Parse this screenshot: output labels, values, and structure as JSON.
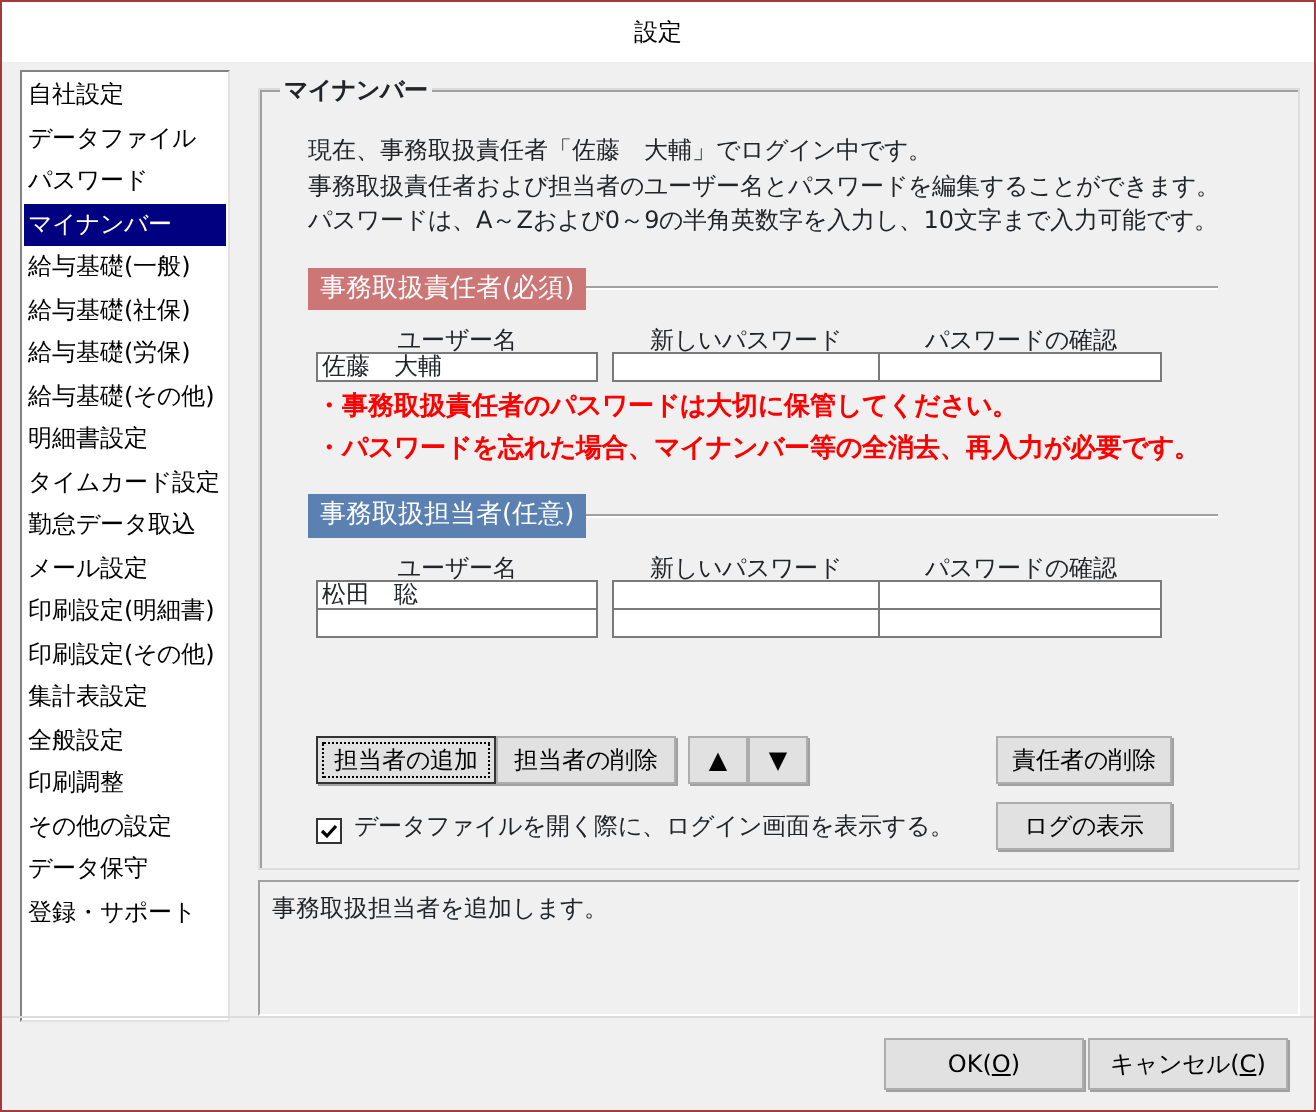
{
  "window": {
    "title": "設定"
  },
  "sidebar": {
    "items": [
      {
        "label": "自社設定",
        "selected": false
      },
      {
        "label": "データファイル",
        "selected": false
      },
      {
        "label": "パスワード",
        "selected": false
      },
      {
        "label": "マイナンバー",
        "selected": true
      },
      {
        "label": "給与基礎(一般)",
        "selected": false
      },
      {
        "label": "給与基礎(社保)",
        "selected": false
      },
      {
        "label": "給与基礎(労保)",
        "selected": false
      },
      {
        "label": "給与基礎(その他)",
        "selected": false
      },
      {
        "label": "明細書設定",
        "selected": false
      },
      {
        "label": "タイムカード設定",
        "selected": false
      },
      {
        "label": "勤怠データ取込",
        "selected": false
      },
      {
        "label": "メール設定",
        "selected": false
      },
      {
        "label": "印刷設定(明細書)",
        "selected": false
      },
      {
        "label": "印刷設定(その他)",
        "selected": false
      },
      {
        "label": "集計表設定",
        "selected": false
      },
      {
        "label": "全般設定",
        "selected": false
      },
      {
        "label": "印刷調整",
        "selected": false
      },
      {
        "label": "その他の設定",
        "selected": false
      },
      {
        "label": "データ保守",
        "selected": false
      },
      {
        "label": "登録・サポート",
        "selected": false
      }
    ]
  },
  "panel": {
    "title": "マイナンバー",
    "description": [
      "現在、事務取扱責任者「佐藤　大輔」でログイン中です。",
      "事務取扱責任者および担当者のユーザー名とパスワードを編集することができます。",
      "パスワードは、A～Zおよび0～9の半角英数字を入力し、10文字まで入力可能です。"
    ],
    "sections": [
      {
        "title": "事務取扱責任者(必須)",
        "color": "#cd7676",
        "columns": [
          "ユーザー名",
          "新しいパスワード",
          "パスワードの確認"
        ],
        "rows": [
          {
            "kind": "entry",
            "user_name": "佐藤　大輔"
          }
        ],
        "warnings": [
          "・事務取扱責任者のパスワードは大切に保管してください。",
          "・パスワードを忘れた場合、マイナンバー等の全消去、再入力が必要です。"
        ]
      },
      {
        "title": "事務取扱担当者(任意)",
        "color": "#5b80b2",
        "columns": [
          "ユーザー名",
          "新しいパスワード",
          "パスワードの確認"
        ],
        "rows": [
          {
            "kind": "entry",
            "user_name": "松田　聡"
          },
          {
            "kind": "blank"
          }
        ]
      }
    ],
    "buttons": [
      {
        "label": "担当者の追加",
        "focused": true
      },
      {
        "label": "担当者の削除",
        "focused": false
      }
    ],
    "arrows": [
      "▲",
      "▼"
    ],
    "side_buttons": [
      "責任者の削除",
      "ログの表示"
    ],
    "checkbox": {
      "label": "データファイルを開く際に、ログイン画面を表示する。",
      "checked": true
    }
  },
  "status_text": "事務取扱担当者を追加します。",
  "dialog_buttons": [
    {
      "label_parts": [
        "OK(",
        "O",
        ")"
      ]
    },
    {
      "label_parts": [
        "キャンセル(",
        "C",
        ")"
      ]
    }
  ]
}
